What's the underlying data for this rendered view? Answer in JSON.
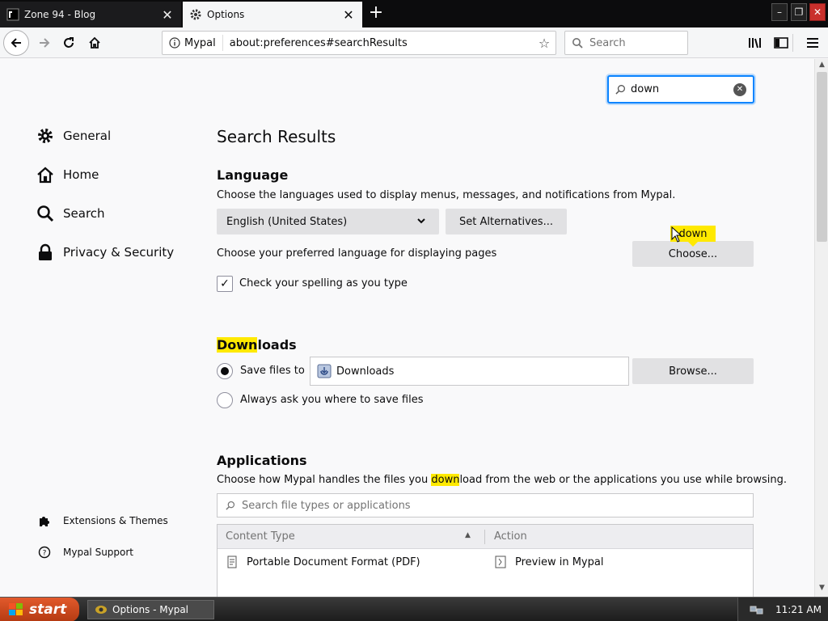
{
  "tabs": [
    {
      "title": "Zone 94 - Blog"
    },
    {
      "title": "Options"
    }
  ],
  "toolbar": {
    "identity_label": "Mypal",
    "url": "about:preferences#searchResults",
    "search_placeholder": "Search"
  },
  "prefs_search": {
    "value": "down"
  },
  "categories": [
    {
      "label": "General"
    },
    {
      "label": "Home"
    },
    {
      "label": "Search"
    },
    {
      "label": "Privacy & Security"
    }
  ],
  "bottom_links": [
    {
      "label": "Extensions & Themes"
    },
    {
      "label": "Mypal Support"
    }
  ],
  "main": {
    "heading": "Search Results",
    "language": {
      "title": "Language",
      "desc": "Choose the languages used to display menus, messages, and notifications from Mypal.",
      "selected_language": "English (United States)",
      "alternatives_button": "Set Alternatives...",
      "pages_desc": "Choose your preferred language for displaying pages",
      "choose_button": "Choose...",
      "spelling_label": "Check your spelling as you type",
      "spelling_checked": true
    },
    "downloads": {
      "title_highlight": "Down",
      "title_rest": "loads",
      "save_label": "Save files to",
      "folder": "Downloads",
      "browse_button": "Browse...",
      "ask_label": "Always ask you where to save files"
    },
    "applications": {
      "title": "Applications",
      "desc_before": "Choose how Mypal handles the files you ",
      "desc_highlight": "down",
      "desc_after": "load from the web or the applications you use while browsing.",
      "filter_placeholder": "Search file types or applications",
      "col_content_type": "Content Type",
      "col_action": "Action",
      "rows": [
        {
          "type": "Portable Document Format (PDF)",
          "action": "Preview in Mypal"
        }
      ]
    }
  },
  "search_tooltip": "down",
  "taskbar": {
    "start_label": "start",
    "task_label": "Options - Mypal",
    "clock": "11:21 AM"
  },
  "colors": {
    "accent": "#0a84ff",
    "highlight": "#ffe900"
  }
}
